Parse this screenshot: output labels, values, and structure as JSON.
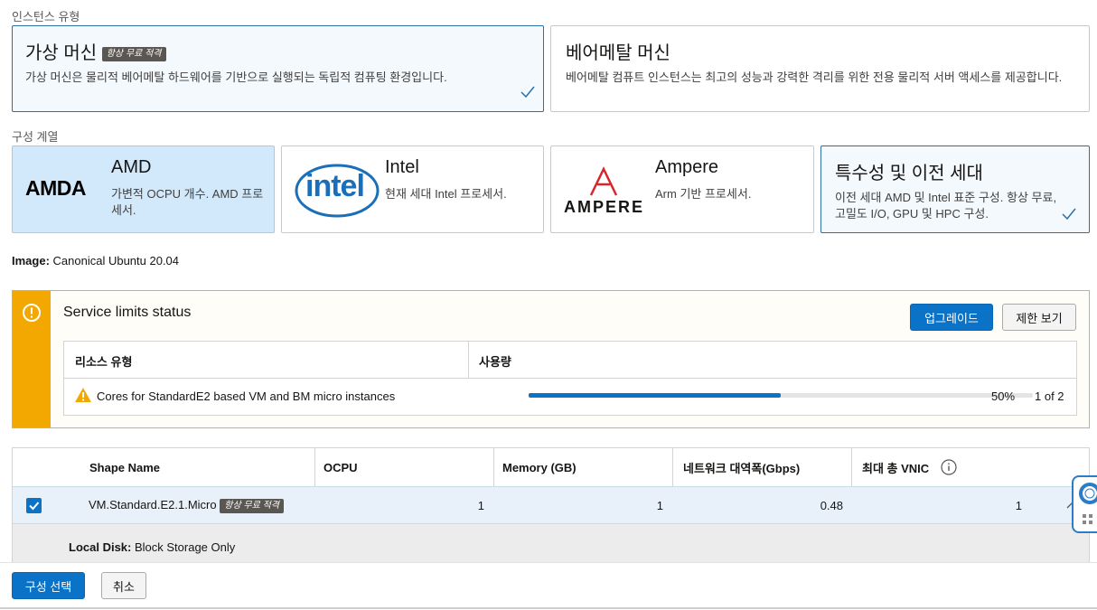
{
  "instance_type": {
    "label": "인스턴스 유형",
    "options": [
      {
        "title": "가상 머신",
        "badge": "항상 무료 적격",
        "desc": "가상 머신은 물리적 베어메탈 하드웨어를 기반으로 실행되는 독립적 컴퓨팅 환경입니다."
      },
      {
        "title": "베어메탈 머신",
        "desc": "베어메탈 컴퓨트 인스턴스는 최고의 성능과 강력한 격리를 위한 전용 물리적 서버 액세스를 제공합니다."
      }
    ]
  },
  "shape_series": {
    "label": "구성 계열",
    "options": [
      {
        "logo": "AMDA",
        "title": "AMD",
        "desc": "가변적 OCPU 개수. AMD 프로세서."
      },
      {
        "logo": "intel",
        "title": "Intel",
        "desc": "현재 세대 Intel 프로세서."
      },
      {
        "logo": "AMPERE",
        "title": "Ampere",
        "desc": "Arm 기반 프로세서."
      },
      {
        "title": "특수성 및 이전 세대",
        "desc": "이전 세대 AMD 및 Intel 표준 구성. 항상 무료, 고밀도 I/O, GPU 및 HPC 구성."
      }
    ]
  },
  "image": {
    "label": "Image:",
    "value": "Canonical Ubuntu 20.04"
  },
  "service_limits": {
    "title": "Service limits status",
    "upgrade_label": "업그레이드",
    "view_limits_label": "제한 보기",
    "columns": [
      "리소스 유형",
      "사용량"
    ],
    "row": {
      "resource": "Cores for StandardE2 based VM and BM micro instances",
      "percent_label": "50%",
      "usage_fraction": 0.5,
      "count": "1 of 2"
    }
  },
  "shapes_table": {
    "columns": [
      "Shape Name",
      "OCPU",
      "Memory (GB)",
      "네트워크 대역폭(Gbps)",
      "최대 총 VNIC"
    ],
    "rows": [
      {
        "name": "VM.Standard.E2.1.Micro",
        "badge": "항상 무료 적격",
        "ocpu": "1",
        "memory": "1",
        "bandwidth": "0.48",
        "vnic": "1"
      }
    ],
    "detail": {
      "label": "Local Disk:",
      "value": "Block Storage Only"
    }
  },
  "footer": {
    "select_label": "구성 선택",
    "cancel_label": "취소"
  },
  "colors": {
    "accent": "#0b73c7",
    "warning": "#f2a800",
    "selected_card": "#d2e8fb"
  }
}
